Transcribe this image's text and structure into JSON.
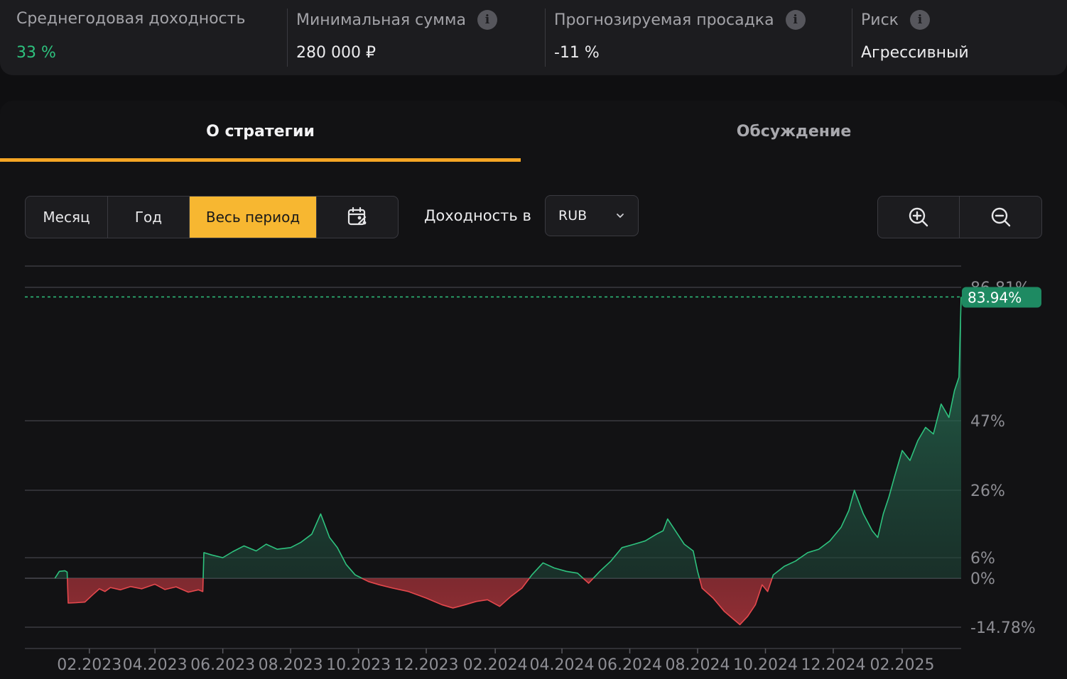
{
  "stats": [
    {
      "label": "Среднегодовая доходность",
      "value": "33 %",
      "info": false
    },
    {
      "label": "Минимальная сумма",
      "value": "280 000 ₽",
      "info": true
    },
    {
      "label": "Прогнозируемая просадка",
      "value": "-11 %",
      "info": true
    },
    {
      "label": "Риск",
      "value": "Агрессивный",
      "info": true
    }
  ],
  "tabs": {
    "about": "О стратегии",
    "discussion": "Обсуждение"
  },
  "periods": {
    "month": "Месяц",
    "year": "Год",
    "all": "Весь период",
    "active": "all"
  },
  "yield_label": "Доходность в",
  "currency": "RUB",
  "icons": {
    "calendar": "calendar-icon",
    "zoom_in": "zoom-in-icon",
    "zoom_out": "zoom-out-icon",
    "info": "info-icon",
    "chevron": "chevron-down-icon"
  },
  "colors": {
    "accent": "#f7b731",
    "tab_underline": "#f5a524",
    "positive": "#2ec27e",
    "negative": "#e5484d",
    "label_badge": "#1e8a62"
  },
  "chart_data": {
    "type": "area",
    "y_ticks": [
      "86.81%",
      "47%",
      "26%",
      "6%",
      "0%",
      "-14.78%"
    ],
    "x_ticks": [
      "02.2023",
      "04.2023",
      "06.2023",
      "08.2023",
      "10.2023",
      "12.2023",
      "02.2024",
      "04.2024",
      "06.2024",
      "08.2024",
      "10.2024",
      "12.2024",
      "02.2025"
    ],
    "current_label": "83.94%",
    "current_value": 83.94,
    "ylim": [
      -14.78,
      86.81
    ],
    "series": [
      {
        "values": [
          [
            "2023-01-01",
            0
          ],
          [
            "2023-01-05",
            2
          ],
          [
            "2023-01-10",
            2.2
          ],
          [
            "2023-01-12",
            1.8
          ],
          [
            "2023-01-13",
            -7.5
          ],
          [
            "2023-01-20",
            -7.4
          ],
          [
            "2023-01-28",
            -7.2
          ],
          [
            "2023-02-04",
            -5
          ],
          [
            "2023-02-10",
            -3.2
          ],
          [
            "2023-02-15",
            -4
          ],
          [
            "2023-02-20",
            -2.8
          ],
          [
            "2023-03-01",
            -3.5
          ],
          [
            "2023-03-10",
            -2.5
          ],
          [
            "2023-03-20",
            -3.2
          ],
          [
            "2023-04-01",
            -1.8
          ],
          [
            "2023-04-10",
            -3.4
          ],
          [
            "2023-04-20",
            -2.6
          ],
          [
            "2023-05-01",
            -4.2
          ],
          [
            "2023-05-10",
            -3.5
          ],
          [
            "2023-05-14",
            -4
          ],
          [
            "2023-05-15",
            7.5
          ],
          [
            "2023-05-22",
            6.8
          ],
          [
            "2023-06-01",
            6
          ],
          [
            "2023-06-10",
            7.8
          ],
          [
            "2023-06-20",
            9.5
          ],
          [
            "2023-07-01",
            8
          ],
          [
            "2023-07-10",
            10
          ],
          [
            "2023-07-20",
            8.5
          ],
          [
            "2023-08-01",
            9
          ],
          [
            "2023-08-10",
            10.5
          ],
          [
            "2023-08-20",
            13
          ],
          [
            "2023-08-28",
            19
          ],
          [
            "2023-09-05",
            12
          ],
          [
            "2023-09-12",
            9
          ],
          [
            "2023-09-20",
            4
          ],
          [
            "2023-09-28",
            1
          ],
          [
            "2023-10-10",
            -1
          ],
          [
            "2023-10-20",
            -2
          ],
          [
            "2023-11-01",
            -3
          ],
          [
            "2023-11-15",
            -4
          ],
          [
            "2023-12-01",
            -6
          ],
          [
            "2023-12-15",
            -8
          ],
          [
            "2023-12-25",
            -9
          ],
          [
            "2024-01-05",
            -8
          ],
          [
            "2024-01-15",
            -7
          ],
          [
            "2024-01-25",
            -6.5
          ],
          [
            "2024-02-05",
            -8.5
          ],
          [
            "2024-02-15",
            -5.5
          ],
          [
            "2024-02-25",
            -3
          ],
          [
            "2024-03-05",
            1
          ],
          [
            "2024-03-15",
            4.5
          ],
          [
            "2024-03-25",
            3
          ],
          [
            "2024-04-05",
            2
          ],
          [
            "2024-04-15",
            1.5
          ],
          [
            "2024-04-25",
            -1.5
          ],
          [
            "2024-05-05",
            2
          ],
          [
            "2024-05-15",
            5
          ],
          [
            "2024-05-25",
            9
          ],
          [
            "2024-06-05",
            10
          ],
          [
            "2024-06-15",
            11
          ],
          [
            "2024-06-25",
            13
          ],
          [
            "2024-07-01",
            14
          ],
          [
            "2024-07-05",
            17.5
          ],
          [
            "2024-07-10",
            15
          ],
          [
            "2024-07-20",
            10
          ],
          [
            "2024-07-28",
            8
          ],
          [
            "2024-08-01",
            2
          ],
          [
            "2024-08-05",
            -3
          ],
          [
            "2024-08-15",
            -6
          ],
          [
            "2024-08-25",
            -10
          ],
          [
            "2024-09-01",
            -12
          ],
          [
            "2024-09-08",
            -14
          ],
          [
            "2024-09-15",
            -11.5
          ],
          [
            "2024-09-22",
            -8
          ],
          [
            "2024-09-28",
            -2
          ],
          [
            "2024-10-03",
            -4
          ],
          [
            "2024-10-08",
            1
          ],
          [
            "2024-10-18",
            3.5
          ],
          [
            "2024-10-28",
            5
          ],
          [
            "2024-11-08",
            7.5
          ],
          [
            "2024-11-18",
            8.5
          ],
          [
            "2024-11-28",
            11
          ],
          [
            "2024-12-08",
            15
          ],
          [
            "2024-12-15",
            20
          ],
          [
            "2024-12-20",
            26
          ],
          [
            "2024-12-28",
            19
          ],
          [
            "2025-01-05",
            14
          ],
          [
            "2025-01-10",
            12
          ],
          [
            "2025-01-15",
            19
          ],
          [
            "2025-01-20",
            24
          ],
          [
            "2025-01-25",
            30
          ],
          [
            "2025-02-01",
            38
          ],
          [
            "2025-02-08",
            35
          ],
          [
            "2025-02-15",
            41
          ],
          [
            "2025-02-22",
            45
          ],
          [
            "2025-03-01",
            43
          ],
          [
            "2025-03-08",
            52
          ],
          [
            "2025-03-15",
            48
          ],
          [
            "2025-03-20",
            56
          ],
          [
            "2025-03-24",
            60
          ],
          [
            "2025-03-26",
            84
          ]
        ]
      }
    ]
  }
}
